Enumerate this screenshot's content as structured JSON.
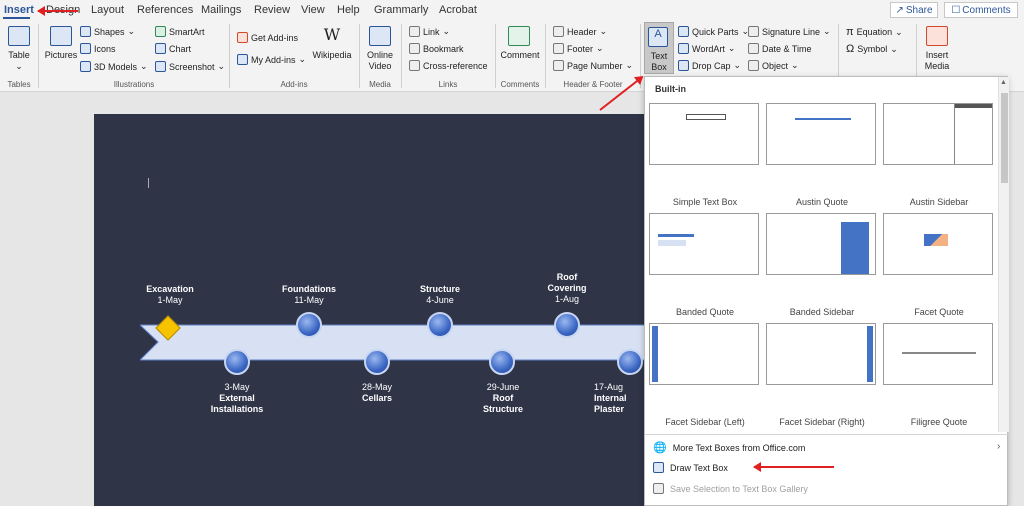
{
  "tabs": [
    "Insert",
    "Design",
    "Layout",
    "References",
    "Mailings",
    "Review",
    "View",
    "Help",
    "Grammarly",
    "Acrobat"
  ],
  "share_label": "Share",
  "comments_label": "Comments",
  "ribbon": {
    "tables": {
      "table": "Table",
      "group": "Tables"
    },
    "illustrations": {
      "pictures": "Pictures",
      "shapes": "Shapes",
      "icons": "Icons",
      "models": "3D Models",
      "smartart": "SmartArt",
      "chart": "Chart",
      "screenshot": "Screenshot",
      "group": "Illustrations"
    },
    "addins": {
      "get": "Get Add-ins",
      "my": "My Add-ins",
      "wikipedia": "Wikipedia",
      "group": "Add-ins"
    },
    "media": {
      "online_video_1": "Online",
      "online_video_2": "Video",
      "group": "Media"
    },
    "links": {
      "link": "Link",
      "bookmark": "Bookmark",
      "cross": "Cross-reference",
      "group": "Links"
    },
    "comments": {
      "comment": "Comment",
      "group": "Comments"
    },
    "header_footer": {
      "header": "Header",
      "footer": "Footer",
      "page_number": "Page Number",
      "group": "Header & Footer"
    },
    "text": {
      "textbox_1": "Text",
      "textbox_2": "Box",
      "quick_parts": "Quick Parts",
      "wordart": "WordArt",
      "drop_cap": "Drop Cap",
      "signature": "Signature Line",
      "datetime": "Date & Time",
      "object": "Object"
    },
    "symbols": {
      "equation": "Equation",
      "symbol": "Symbol"
    },
    "insert_media": {
      "l1": "Insert",
      "l2": "Media"
    }
  },
  "timeline": {
    "top": [
      {
        "title": "Excavation",
        "date": "1-May"
      },
      {
        "title": "Foundations",
        "date": "11-May"
      },
      {
        "title": "Structure",
        "date": "4-June"
      },
      {
        "title": "Roof",
        "title2": "Covering",
        "date": "1-Aug"
      }
    ],
    "bottom": [
      {
        "date": "3-May",
        "title": "External",
        "title2": "Installations"
      },
      {
        "date": "28-May",
        "title": "Cellars"
      },
      {
        "date": "29-June",
        "title": "Roof",
        "title2": "Structure"
      },
      {
        "date": "17-Aug",
        "title": "Internal",
        "title2": "Plaster"
      }
    ]
  },
  "gallery": {
    "heading": "Built-in",
    "names": [
      "Simple Text Box",
      "Austin Quote",
      "Austin Sidebar",
      "Banded Quote",
      "Banded Sidebar",
      "Facet Quote",
      "Facet Sidebar (Left)",
      "Facet Sidebar (Right)",
      "Filigree Quote"
    ],
    "more": "More Text Boxes from Office.com",
    "draw": "Draw Text Box",
    "save": "Save Selection to Text Box Gallery"
  }
}
